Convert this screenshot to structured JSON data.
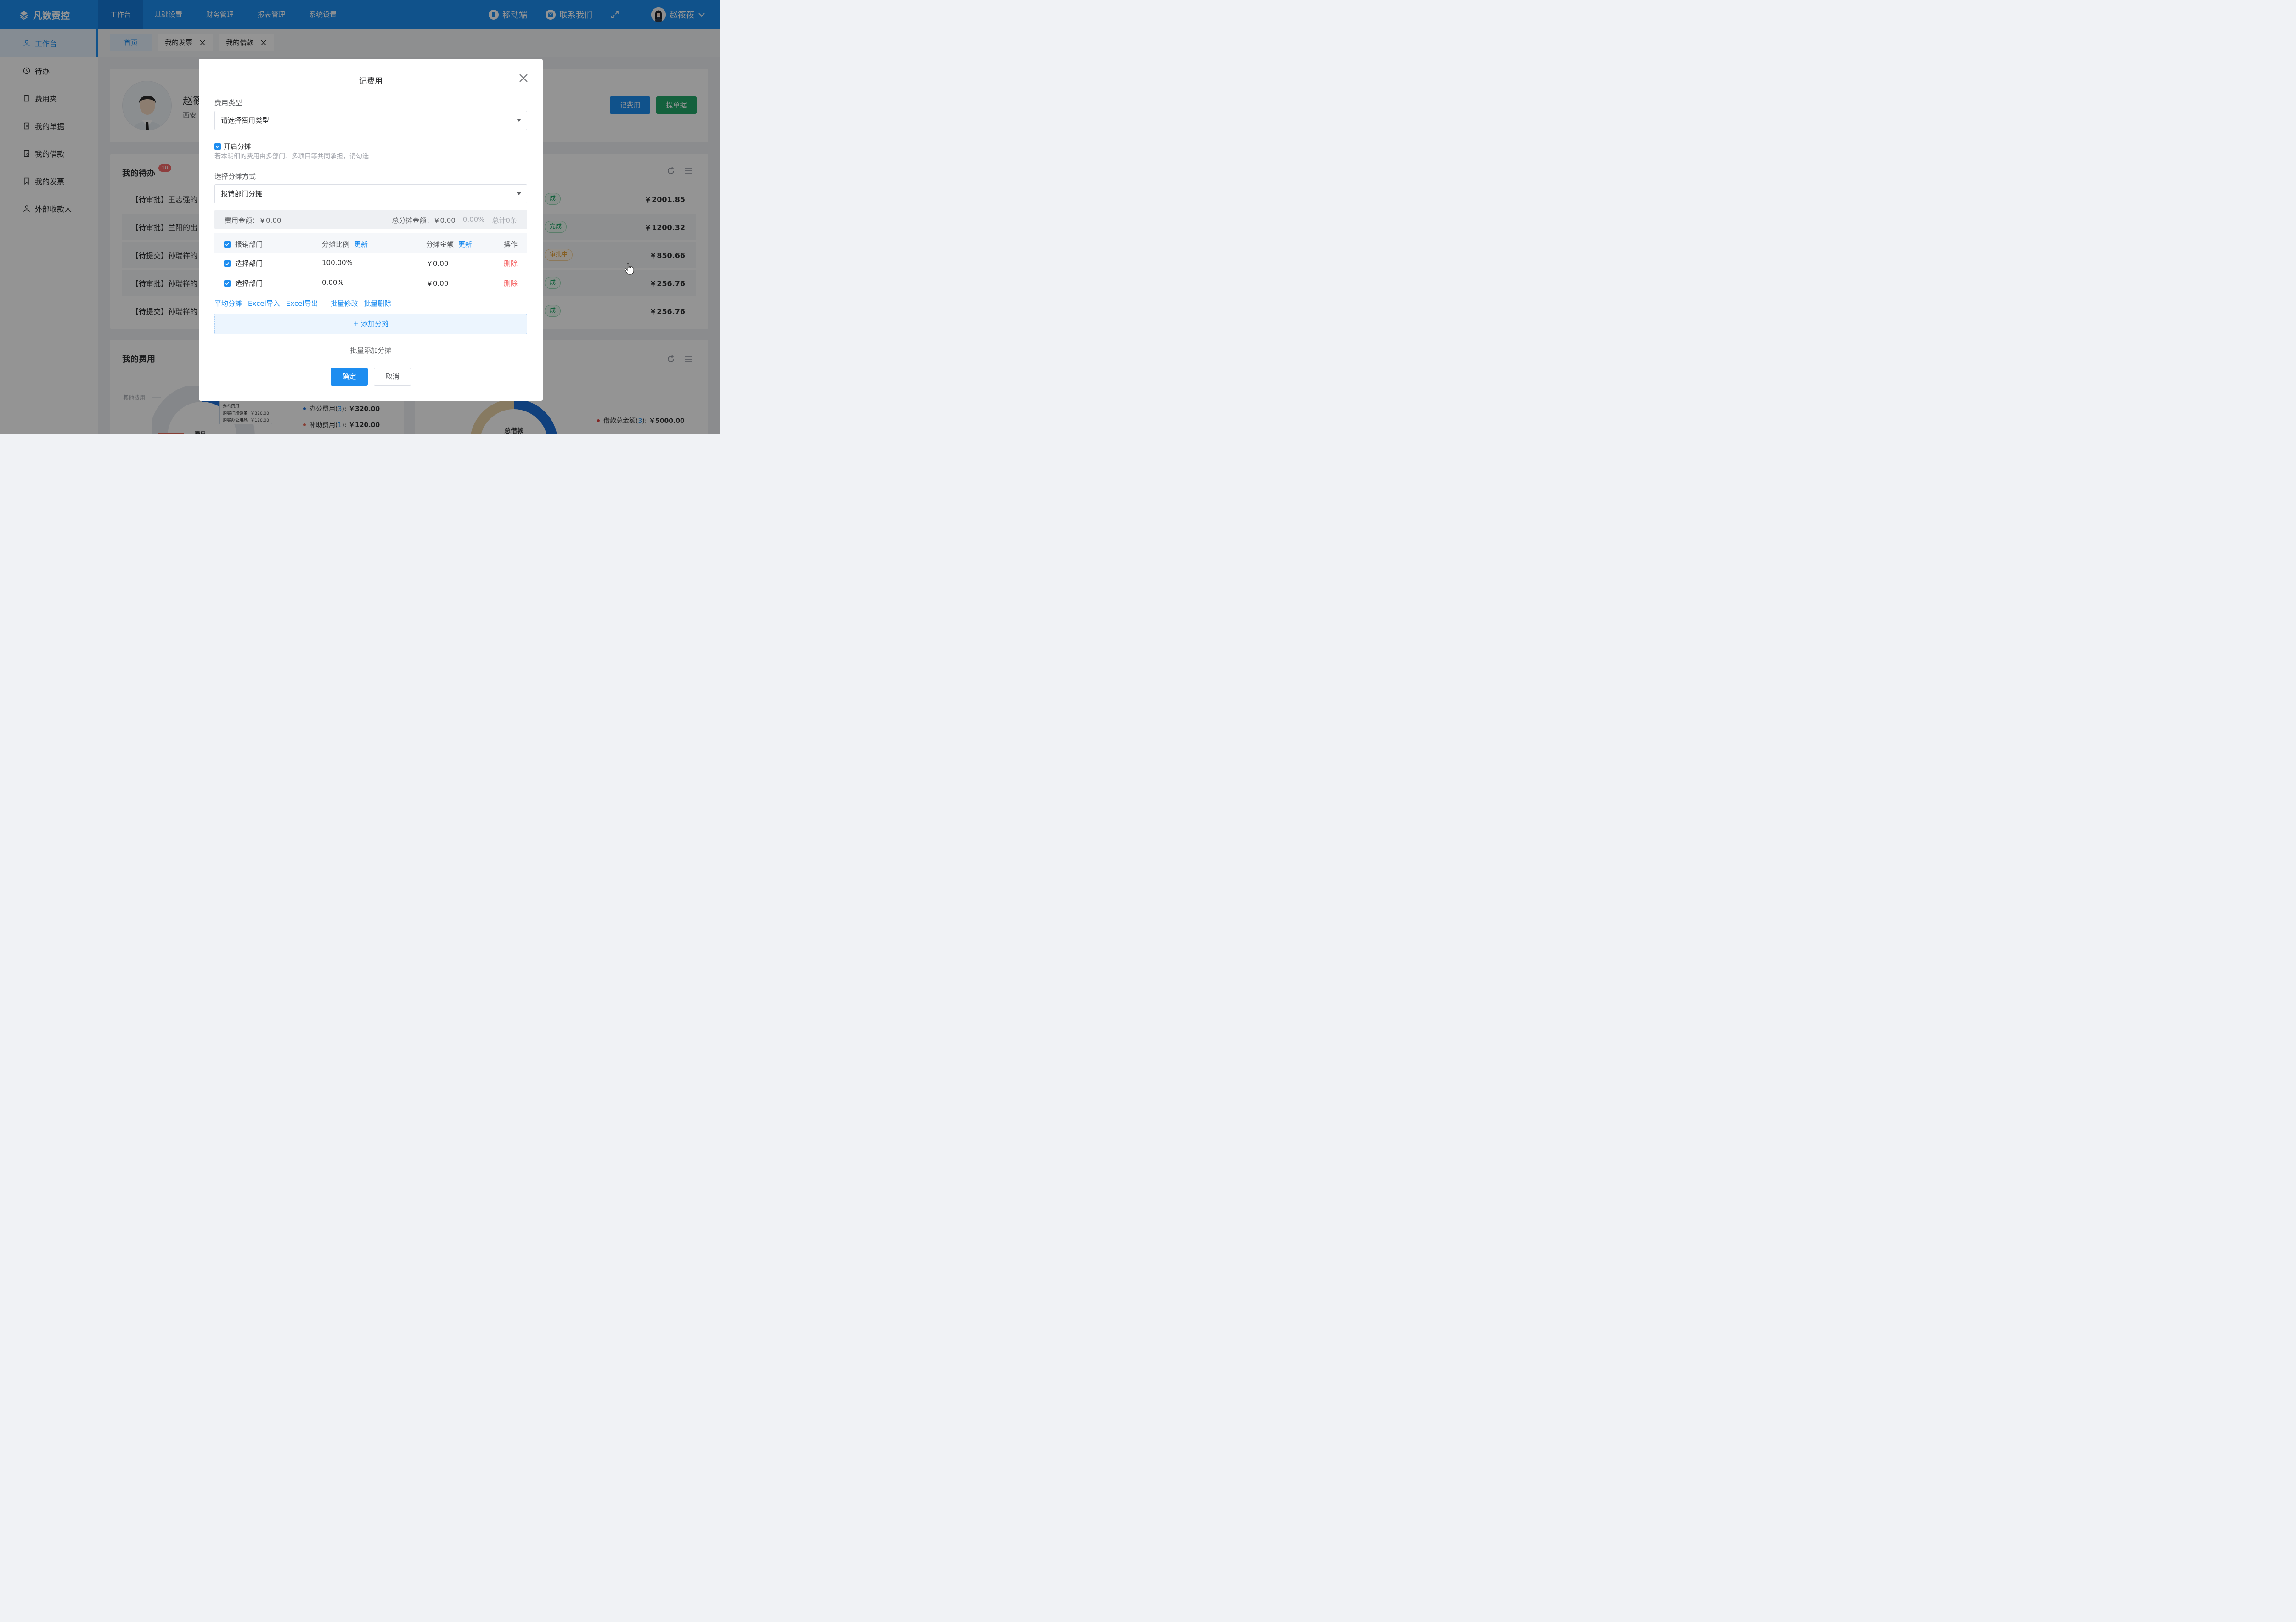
{
  "app": {
    "name": "凡数费控"
  },
  "nav": [
    "工作台",
    "基础设置",
    "财务管理",
    "报表管理",
    "系统设置"
  ],
  "top_right": {
    "mobile": "移动端",
    "contact": "联系我们",
    "user": "赵筱筱"
  },
  "sidebar": [
    "工作台",
    "待办",
    "费用夹",
    "我的单据",
    "我的借款",
    "我的发票",
    "外部收款人"
  ],
  "tabs": {
    "home": "首页",
    "items": [
      "我的发票",
      "我的借款"
    ]
  },
  "profile": {
    "name": "赵筱",
    "org": "西安",
    "record_btn": "记费用",
    "submit_btn": "提单据"
  },
  "todo": {
    "title": "我的待办",
    "badge": "10",
    "rows": [
      {
        "text": "【待审批】王志强的",
        "status": "成",
        "amount": "￥2001.85"
      },
      {
        "text": "【待审批】兰阳的出",
        "status": "完成",
        "amount": "￥1200.32"
      },
      {
        "text": "【待提交】孙瑞祥的",
        "status": "审批中",
        "amount": "￥850.66"
      },
      {
        "text": "【待审批】孙瑞祥的",
        "status": "成",
        "amount": "￥256.76"
      },
      {
        "text": "【待提交】孙瑞祥的",
        "status": "成",
        "amount": "￥256.76"
      }
    ]
  },
  "expense": {
    "title": "我的费用",
    "other_label": "其他费用",
    "center_label": "费用",
    "tooltip_title": "办公费用",
    "tooltip_items": [
      {
        "name": "购买打印设备",
        "amount": "￥320.00"
      },
      {
        "name": "购买办公用品",
        "amount": "￥120.00"
      }
    ],
    "legend": [
      {
        "name": "办公费用(",
        "count": "3",
        "tail": "):",
        "amount": "￥320.00",
        "color": "#1d6fd8"
      },
      {
        "name": "补助费用(",
        "count": "1",
        "tail": "):",
        "amount": "￥120.00",
        "color": "#e96b5b"
      }
    ]
  },
  "loan": {
    "center_label": "总借款",
    "legend": {
      "name": "借款总金额(",
      "count": "3",
      "tail": "):",
      "amount": "￥5000.00",
      "color": "#e0403d"
    }
  },
  "modal": {
    "title": "记费用",
    "type_label": "费用类型",
    "type_placeholder": "请选择费用类型",
    "split_enable": "开启分摊",
    "split_hint": "若本明细的费用由多部门、多项目等共同承担，请勾选",
    "method_label": "选择分摊方式",
    "method_value": "报销部门分摊",
    "summary": {
      "amount_label": "费用金额：",
      "amount": "￥0.00",
      "split_label": "总分摊金额：",
      "split_amount": "￥0.00",
      "percent": "0.00%",
      "count": "总计0条"
    },
    "table": {
      "headers": {
        "dept": "报销部门",
        "ratio": "分摊比例",
        "ratio_update": "更新",
        "amount": "分摊金额",
        "amount_update": "更新",
        "action": "操作"
      },
      "rows": [
        {
          "dept": "选择部门",
          "ratio": "100.00%",
          "amount": "￥0.00",
          "action": "删除"
        },
        {
          "dept": "选择部门",
          "ratio": "0.00%",
          "amount": "￥0.00",
          "action": "删除"
        }
      ]
    },
    "toolbar": [
      "平均分摊",
      "Excel导入",
      "Excel导出",
      "批量修改",
      "批量删除"
    ],
    "add_split": "添加分摊",
    "batch_add": "批量添加分摊",
    "ok": "确定",
    "cancel": "取消"
  }
}
